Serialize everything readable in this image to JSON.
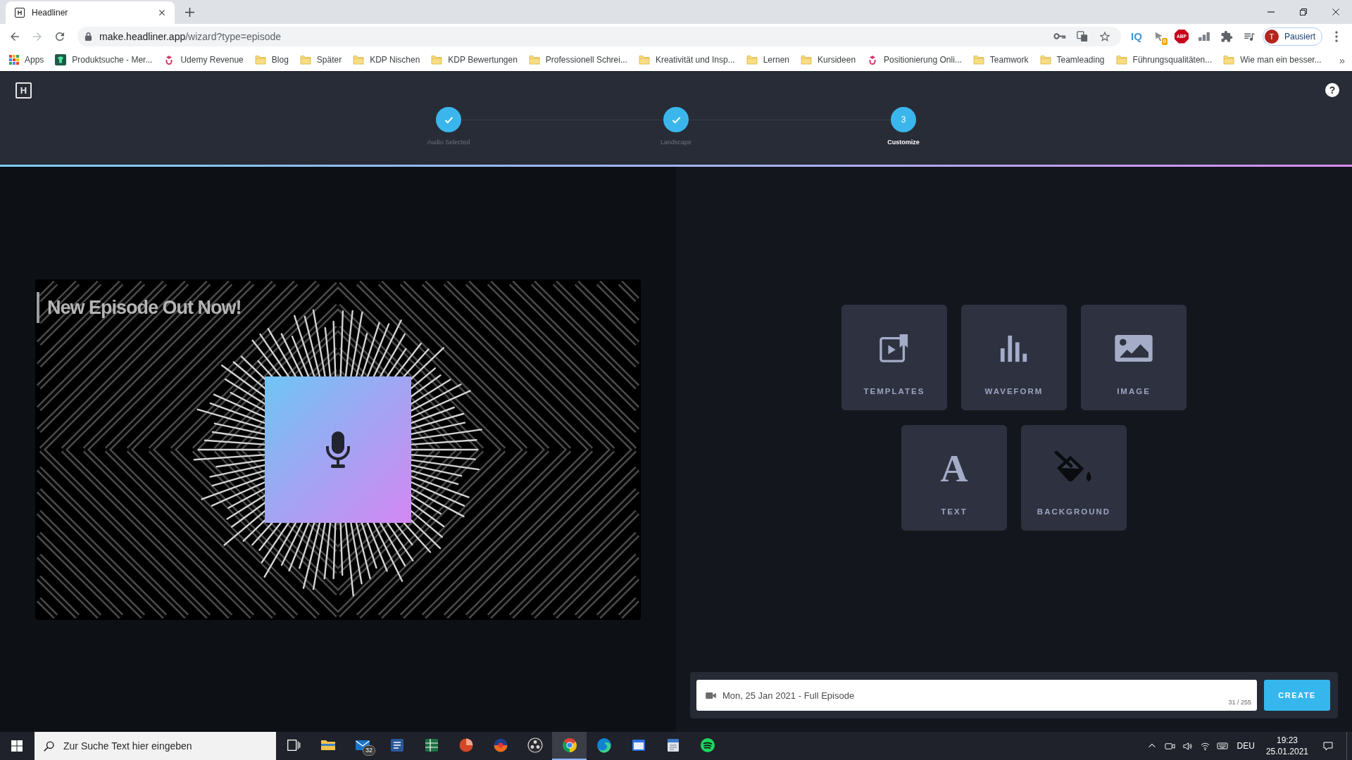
{
  "browser": {
    "tabs": [
      {
        "title": "Headliner",
        "favicon": "H",
        "selected": true
      }
    ],
    "nav_buttons": [
      {
        "kind": "back",
        "disabled": false
      },
      {
        "kind": "forward",
        "disabled": true
      },
      {
        "kind": "reload",
        "disabled": false
      }
    ],
    "url": "make.headliner.app/wizard?type=episode",
    "extensions": [
      {
        "kind": "label",
        "label": "IQ"
      },
      {
        "kind": "pin",
        "badge": "0"
      },
      {
        "kind": "octagon",
        "label": "ABP"
      },
      {
        "kind": "bars"
      },
      {
        "kind": "puzzle"
      },
      {
        "kind": "media"
      }
    ],
    "profile": {
      "initial": "T",
      "label": "Pausiert"
    },
    "bookmarks": [
      {
        "label": "Apps",
        "kind": "apps"
      },
      {
        "label": "Produktsuche - Mer...",
        "kind": "shirt"
      },
      {
        "label": "Udemy Revenue",
        "kind": "cap"
      },
      {
        "label": "Blog",
        "kind": "folder"
      },
      {
        "label": "Später",
        "kind": "folder"
      },
      {
        "label": "KDP Nischen",
        "kind": "folder"
      },
      {
        "label": "KDP Bewertungen",
        "kind": "folder"
      },
      {
        "label": "Professionell Schrei...",
        "kind": "folder"
      },
      {
        "label": "Kreativität und Insp...",
        "kind": "folder"
      },
      {
        "label": "Lernen",
        "kind": "folder"
      },
      {
        "label": "Kursideen",
        "kind": "folder"
      },
      {
        "label": "Positionierung Onli...",
        "kind": "cap"
      },
      {
        "label": "Teamwork",
        "kind": "folder"
      },
      {
        "label": "Teamleading",
        "kind": "folder"
      },
      {
        "label": "Führungsqualitäten...",
        "kind": "folder"
      },
      {
        "label": "Wie man ein besser...",
        "kind": "folder"
      }
    ],
    "bookmarks_overflow": "»"
  },
  "app": {
    "logo": "H",
    "help": "?",
    "steps": [
      {
        "label": "Audio Selected",
        "done": true,
        "selected": false
      },
      {
        "label": "Landscape",
        "done": true,
        "selected": false
      },
      {
        "label": "Customize",
        "number": "3",
        "done": false,
        "selected": true
      }
    ],
    "preview": {
      "headline": "New Episode Out Now!"
    },
    "tools": [
      {
        "kind": "templates",
        "label": "TEMPLATES"
      },
      {
        "kind": "waveform",
        "label": "WAVEFORM"
      },
      {
        "kind": "image",
        "label": "IMAGE"
      },
      {
        "kind": "text",
        "label": "TEXT",
        "glyph": "A"
      },
      {
        "kind": "background",
        "label": "BACKGROUND"
      }
    ],
    "title_field": {
      "value": "Mon, 25 Jan 2021 - Full Episode",
      "counter": "31 / 255"
    },
    "create_button": "CREATE"
  },
  "taskbar": {
    "search_placeholder": "Zur Suche Text hier eingeben",
    "apps": [
      {
        "kind": "taskview",
        "selected": false
      },
      {
        "kind": "explorer",
        "selected": false
      },
      {
        "kind": "mail",
        "badge": "32",
        "selected": false
      },
      {
        "kind": "word",
        "selected": false
      },
      {
        "kind": "excel",
        "selected": false
      },
      {
        "kind": "powerpoint",
        "selected": false
      },
      {
        "kind": "disc",
        "selected": false
      },
      {
        "kind": "obs",
        "selected": false
      },
      {
        "kind": "chrome",
        "selected": true
      },
      {
        "kind": "edge",
        "selected": false
      },
      {
        "kind": "window",
        "selected": false
      },
      {
        "kind": "document",
        "selected": false
      },
      {
        "kind": "spotify",
        "selected": false
      }
    ],
    "language": "DEU",
    "time": "19:23",
    "date": "25.01.2021"
  }
}
